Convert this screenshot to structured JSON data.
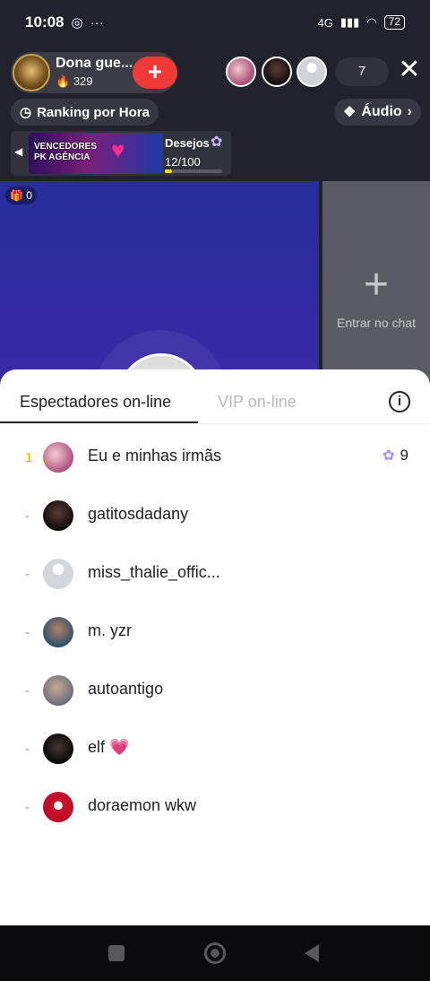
{
  "status_bar": {
    "time": "10:08",
    "network": "4G",
    "battery": "72"
  },
  "header": {
    "host_name": "Dona gue...",
    "likes": "329",
    "viewer_count": "7"
  },
  "controls": {
    "ranking_label": "Ranking por Hora",
    "audio_label": "Áudio"
  },
  "banner": {
    "text_line1": "VENCEDORES",
    "text_line2": "PK AGÊNCIA"
  },
  "desejos": {
    "label": "Desejos",
    "progress": "12/100",
    "progress_fraction": 0.12
  },
  "stage": {
    "gift_count": "0",
    "enter_chat_label": "Entrar no chat"
  },
  "sheet": {
    "tabs": [
      {
        "label": "Espectadores on-line",
        "active": true
      },
      {
        "label": "VIP on-line",
        "active": false
      }
    ],
    "viewers": [
      {
        "rank": "1",
        "name": "Eu e minhas irmãs",
        "badge_value": "9",
        "badge_icon": "bunny-gift-icon"
      },
      {
        "rank": "-",
        "name": "gatitosdadany"
      },
      {
        "rank": "-",
        "name": "miss_thalie_offic..."
      },
      {
        "rank": "-",
        "name": "m. yzr"
      },
      {
        "rank": "-",
        "name": "autoantigo"
      },
      {
        "rank": "-",
        "name": "elf 💗"
      },
      {
        "rank": "-",
        "name": "doraemon wkw"
      }
    ]
  },
  "colors": {
    "accent_red": "#f03a38",
    "stage_blue": "#2f2ea0",
    "rank_gold": "#e3b600"
  }
}
